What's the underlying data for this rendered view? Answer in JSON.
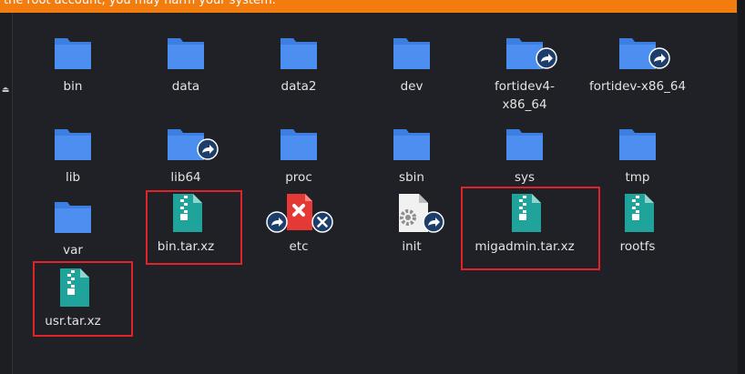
{
  "warning_banner": {
    "text": "the root account, you may harm your system.",
    "color": "#f27c0e"
  },
  "files": [
    {
      "name": "bin",
      "type": "folder",
      "icon": "folder-icon"
    },
    {
      "name": "data",
      "type": "folder",
      "icon": "folder-icon"
    },
    {
      "name": "data2",
      "type": "folder",
      "icon": "folder-icon"
    },
    {
      "name": "dev",
      "type": "folder",
      "icon": "folder-icon"
    },
    {
      "name_line1": "fortidev4-",
      "name_line2": "x86_64",
      "type": "folder-symlink",
      "icon": "folder-link-icon"
    },
    {
      "name": "fortidev-x86_64",
      "type": "folder-symlink",
      "icon": "folder-link-icon"
    },
    {
      "name": "lib",
      "type": "folder",
      "icon": "folder-icon"
    },
    {
      "name": "lib64",
      "type": "folder-symlink",
      "icon": "folder-link-icon"
    },
    {
      "name": "proc",
      "type": "folder",
      "icon": "folder-icon"
    },
    {
      "name": "sbin",
      "type": "folder",
      "icon": "folder-icon"
    },
    {
      "name": "sys",
      "type": "folder",
      "icon": "folder-icon"
    },
    {
      "name": "tmp",
      "type": "folder",
      "icon": "folder-icon"
    },
    {
      "name": "var",
      "type": "folder",
      "icon": "folder-icon"
    },
    {
      "name": "bin.tar.xz",
      "type": "archive",
      "icon": "archive-icon",
      "highlighted": true
    },
    {
      "name": "etc",
      "type": "broken-symlink",
      "icon": "broken-link-icon"
    },
    {
      "name": "init",
      "type": "executable-symlink",
      "icon": "executable-link-icon"
    },
    {
      "name": "migadmin.tar.xz",
      "type": "archive",
      "icon": "archive-icon",
      "highlighted": true
    },
    {
      "name": "rootfs",
      "type": "archive",
      "icon": "archive-icon"
    },
    {
      "name": "usr.tar.xz",
      "type": "archive",
      "icon": "archive-icon",
      "highlighted": true
    }
  ],
  "colors": {
    "background": "#1f2126",
    "folder": "#3d7fe0",
    "archive": "#1fa39a",
    "highlight": "#e0222b",
    "link_badge": "#1d3d6b",
    "broken": "#e53935"
  }
}
